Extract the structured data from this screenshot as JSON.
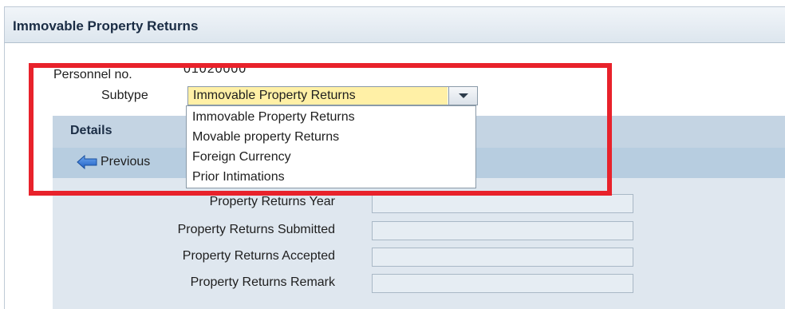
{
  "window": {
    "title": "Immovable Property Returns"
  },
  "personnel": {
    "label": "Personnel no.",
    "value": "01020000"
  },
  "subtype": {
    "label": "Subtype",
    "selected": "Immovable Property Returns",
    "options": [
      "Immovable Property Returns",
      "Movable property Returns",
      "Foreign Currency",
      "Prior Intimations"
    ]
  },
  "details": {
    "title": "Details",
    "previous_label": "Previous",
    "fields": [
      {
        "label": "Property Returns Year",
        "value": ""
      },
      {
        "label": "Property Returns Submitted",
        "value": ""
      },
      {
        "label": "Property Returns Accepted",
        "value": ""
      },
      {
        "label": "Property Returns Remark",
        "value": ""
      }
    ]
  },
  "colors": {
    "highlight": "#e8222b",
    "selected_bg": "#fff0a6",
    "panel_bg": "#dfe7ef",
    "header_bg": "#c4d4e3",
    "icon_blue": "#2b6fd6"
  },
  "icons": {
    "previous": "arrow-left-icon",
    "dropdown": "chevron-down-icon"
  }
}
